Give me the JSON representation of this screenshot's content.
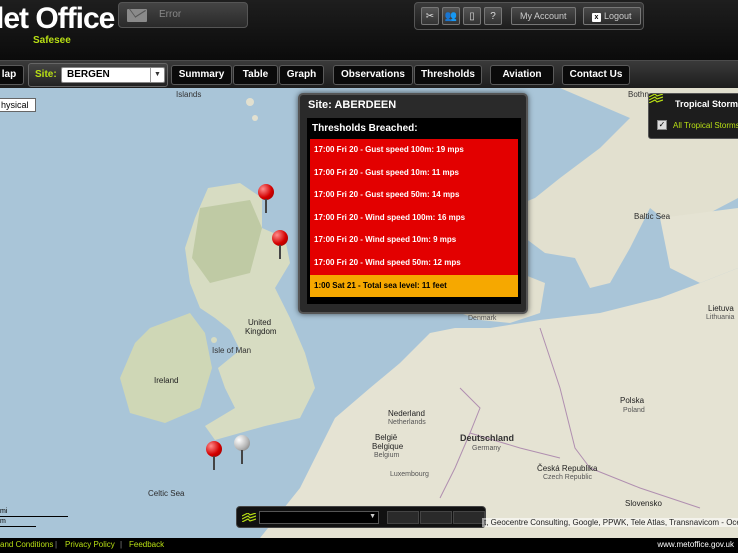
{
  "header": {
    "logo": "let Office",
    "logo_sub": "Safesee",
    "error_label": "Error",
    "tools": [
      "✂",
      "👥",
      "▯",
      "?"
    ],
    "my_account": "My Account",
    "logout": "Logout"
  },
  "nav": {
    "map_btn": "lap",
    "site_label": "Site:",
    "site_value": "BERGEN",
    "summary": "Summary",
    "table": "Table",
    "graph": "Graph",
    "observations": "Observations",
    "thresholds": "Thresholds",
    "aviation": "Aviation",
    "contact": "Contact Us"
  },
  "map": {
    "physical_btn": "hysical",
    "labels": {
      "islands": "Islands",
      "bothn": "Bothn",
      "baltic_sea": "Baltic Sea",
      "denmark": "Denmark",
      "united_kingdom_1": "United",
      "united_kingdom_2": "Kingdom",
      "isle_of_man": "Isle of Man",
      "ireland": "Ireland",
      "nederland": "Nederland",
      "netherlands": "Netherlands",
      "belgie": "België",
      "belgique": "Belgique",
      "belgium": "Belgium",
      "luxembourg": "Luxembourg",
      "deutschland": "Deutschland",
      "germany": "Germany",
      "polska": "Polska",
      "poland": "Poland",
      "ceska": "Česká Republika",
      "czech": "Czech Republic",
      "slovensko": "Slovensko",
      "lietuva": "Lietuva",
      "lithuania": "Lithuania",
      "celtic_sea": "Celtic Sea"
    },
    "scale_top": "mi",
    "scale_bottom": "m",
    "attribution": "t, Geocentre Consulting, Google, PPWK, Tele Atlas, Transnavicom - Oceanwise"
  },
  "popup": {
    "title": "Site: ABERDEEN",
    "subtitle": "Thresholds Breached:",
    "breaches": [
      {
        "text": "17:00 Fri 20 - Gust speed 100m: 19 mps",
        "level": "red"
      },
      {
        "text": "17:00 Fri 20 - Gust speed 10m: 11 mps",
        "level": "red"
      },
      {
        "text": "17:00 Fri 20 - Gust speed 50m: 14 mps",
        "level": "red"
      },
      {
        "text": "17:00 Fri 20 - Wind speed 100m: 16 mps",
        "level": "red"
      },
      {
        "text": "17:00 Fri 20 - Wind speed 10m: 9 mps",
        "level": "red"
      },
      {
        "text": "17:00 Fri 20 - Wind speed 50m: 12 mps",
        "level": "red"
      },
      {
        "text": "1:00 Sat 21 - Total sea level: 11 feet",
        "level": "orange"
      }
    ]
  },
  "storms": {
    "title": "Tropical Storms",
    "item": "All Tropical Storms",
    "checked": "✓"
  },
  "footer": {
    "terms": "and Conditions",
    "privacy": "Privacy Policy",
    "feedback": "Feedback",
    "site": "www.metoffice.gov.uk",
    "sep": "|"
  },
  "colors": {
    "accent": "#b9e014",
    "breach_red": "#e30000",
    "breach_orange": "#f6a800",
    "sea": "#a9c5d8",
    "land": "#e8e6d6"
  }
}
